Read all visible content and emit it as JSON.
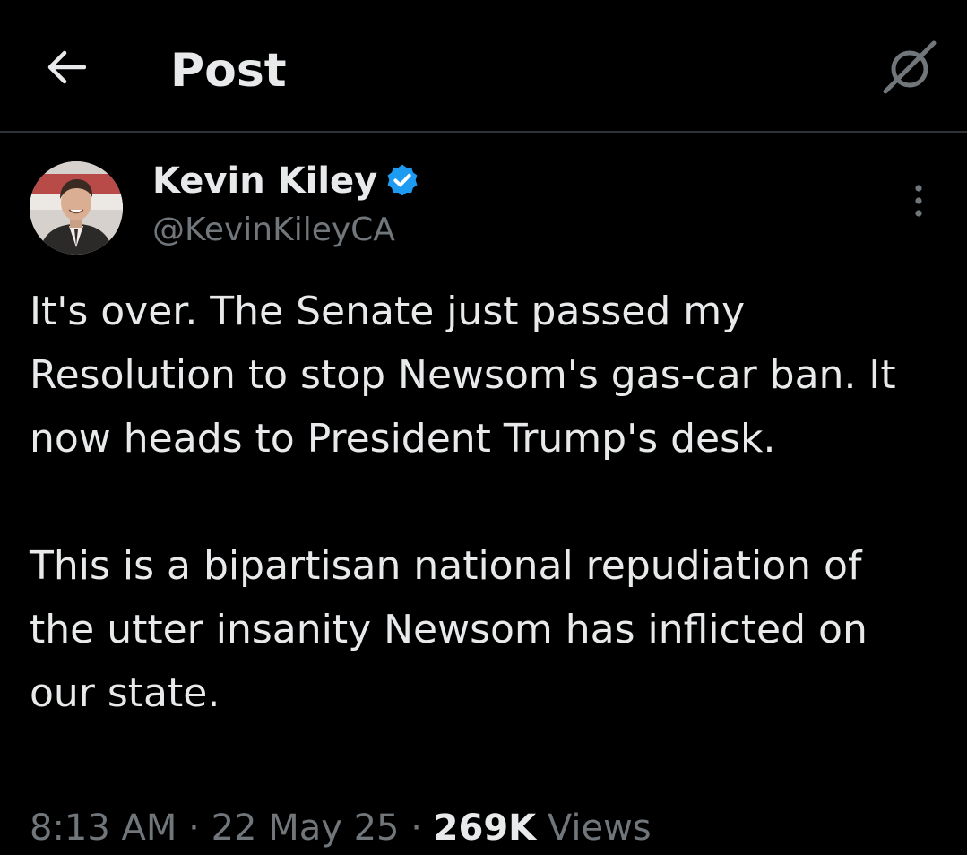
{
  "header": {
    "title": "Post",
    "back_icon": "arrow-left-icon",
    "grok_icon": "grok-icon"
  },
  "author": {
    "name": "Kevin Kiley",
    "handle": "@KevinKileyCA",
    "verified": true,
    "verified_color": "#1d9bf0"
  },
  "post": {
    "paragraphs": [
      "It's over. The Senate just passed my Resolution to stop Newsom's gas-car ban. It now heads to President Trump's desk.",
      "This is a bipartisan national repudiation of the utter insanity Newsom has inflicted on our state."
    ]
  },
  "meta": {
    "time": "8:13 AM",
    "separator": " · ",
    "date": "22 May 25",
    "views_count": "269K",
    "views_label": "Views"
  },
  "colors": {
    "background": "#000000",
    "text_primary": "#e7e9ea",
    "text_secondary": "#71767b",
    "divider": "#2f3336",
    "accent": "#1d9bf0"
  }
}
